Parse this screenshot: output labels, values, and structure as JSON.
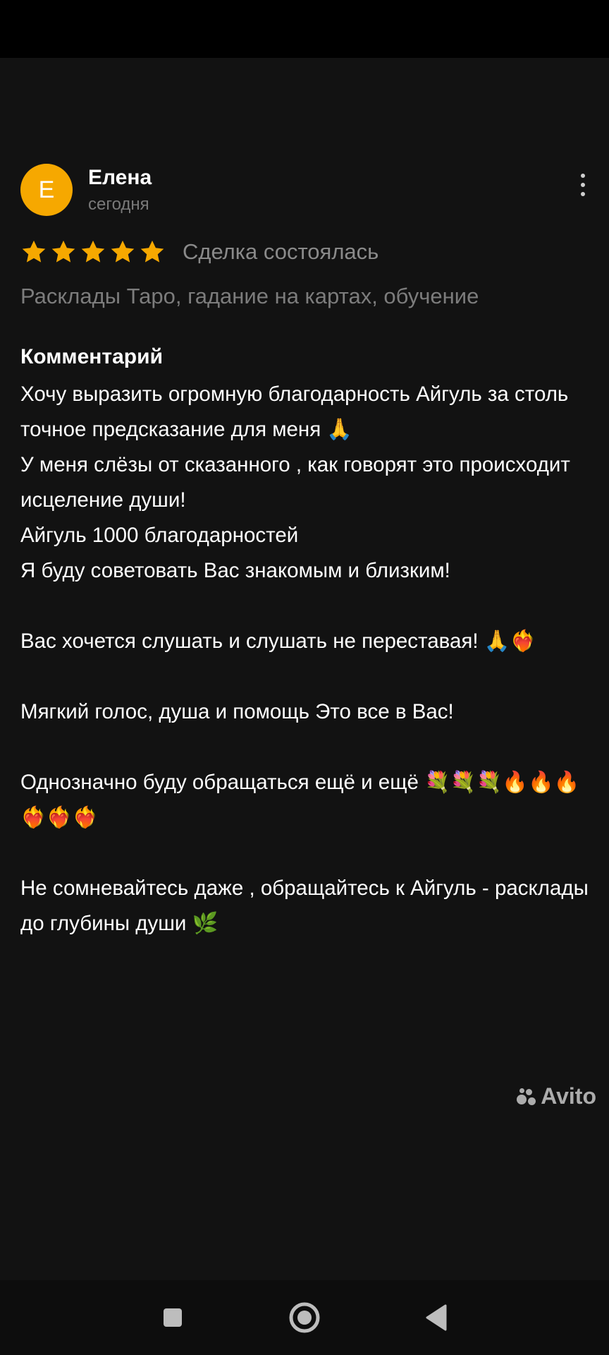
{
  "review": {
    "avatar_letter": "Е",
    "author": "Елена",
    "date": "сегодня",
    "rating": 5,
    "deal_status": "Сделка состоялась",
    "category": "Расклады Таро, гадание на картах, обучение",
    "section_title": "Комментарий",
    "comment": "Хочу выразить огромную благодарность Айгуль за столь точное предсказание для меня 🙏\nУ меня слёзы от сказанного , как говорят это происходит исцеление души!\nАйгуль 1000 благодарностей\nЯ буду советовать Вас знакомым и близким!\n\nВас хочется слушать и слушать не переставая! 🙏❤️‍🔥\n\nМягкий голос, душа и помощь Это все в Вас!\n\nОднозначно буду обращаться ещё и ещё 💐💐💐🔥🔥🔥❤️‍🔥❤️‍🔥❤️‍🔥\n\nНе сомневайтесь даже , обращайтесь к Айгуль - расклады  до глубины души 🌿"
  },
  "watermark": {
    "text": "Avito"
  },
  "nav": {
    "recents_icon": "square-icon",
    "home_icon": "circle-icon",
    "back_icon": "triangle-back-icon"
  },
  "colors": {
    "avatar_bg": "#f6a800",
    "star": "#f6a800",
    "background": "#121212",
    "muted_text": "#7c7c7c"
  }
}
